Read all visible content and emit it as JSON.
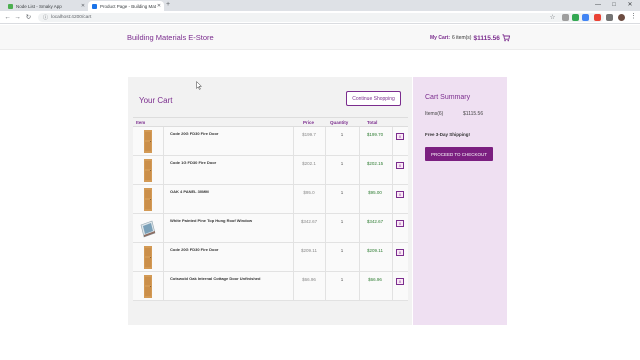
{
  "browser": {
    "tabs": [
      {
        "label": "Node List - Smaky App",
        "favicon_color": "#4caf50"
      },
      {
        "label": "Product Page - Building Materia...",
        "favicon_color": "#1a73e8"
      }
    ],
    "new_tab_symbol": "+",
    "address": "localhost:4200/cart",
    "window_controls": [
      "—",
      "□",
      "✕"
    ]
  },
  "store": {
    "brand": "Building Materials E-Store",
    "cart_label": "My Cart:",
    "cart_count": "6 item(s)",
    "cart_total": "$1115.56"
  },
  "cart": {
    "title": "Your Cart",
    "continue_label": "Continue Shopping",
    "columns": {
      "item": "Item",
      "price": "Price",
      "quantity": "Quantity",
      "total": "Total"
    },
    "remove_label": "X",
    "rows": [
      {
        "name": "Code 20G FD30 Fire Door",
        "price": "$199.7",
        "qty": "1",
        "total": "$199.70",
        "thumb": "door"
      },
      {
        "name": "Code 1G FD30 Fire Door",
        "price": "$202.1",
        "qty": "1",
        "total": "$202.15",
        "thumb": "door"
      },
      {
        "name": "OAK 4 PANEL 30MM",
        "price": "$95.0",
        "qty": "1",
        "total": "$95.00",
        "thumb": "door"
      },
      {
        "name": "White Painted Pine Top Hung Roof Window",
        "price": "$342.67",
        "qty": "1",
        "total": "$342.67",
        "thumb": "window"
      },
      {
        "name": "Code 20G FD30 Fire Door",
        "price": "$209.11",
        "qty": "1",
        "total": "$209.11",
        "thumb": "door"
      },
      {
        "name": "Cotswold Oak Internal Cottage Door Unfinished",
        "price": "$66.96",
        "qty": "1",
        "total": "$66.96",
        "thumb": "door"
      }
    ]
  },
  "summary": {
    "title": "Cart Summary",
    "items_label": "Items(6)",
    "total": "$1115.56",
    "shipping": "Free 3-Day Shipping!",
    "checkout_label": "PROCEED TO CHECKOUT"
  },
  "colors": {
    "accent": "#7b2d8e",
    "summary_bg": "#efe0f2",
    "price_green": "#2e7d32"
  }
}
